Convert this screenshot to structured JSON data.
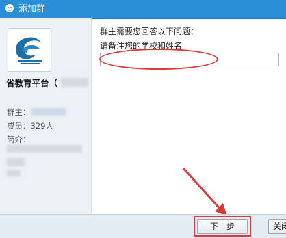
{
  "window": {
    "title": "添加群"
  },
  "group": {
    "name": "省教育平台（",
    "owner_label": "群主：",
    "members_label": "成员：",
    "members_value": "329人",
    "intro_label": "简介："
  },
  "form": {
    "question_header": "群主需要您回答以下问题：",
    "question_text": "请备注您的学校和姓名",
    "answer_value": ""
  },
  "buttons": {
    "next": "下一步",
    "close": "关闭"
  },
  "colors": {
    "titlebar": "#2a8fd6",
    "highlight": "#d93a3a"
  }
}
